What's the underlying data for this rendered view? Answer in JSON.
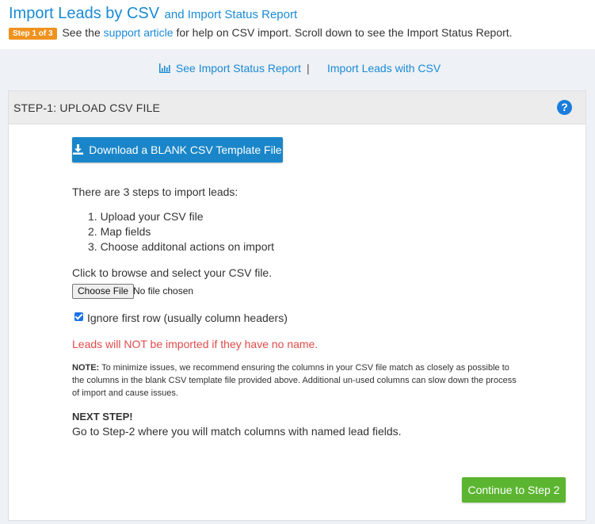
{
  "header": {
    "title_main": "Import Leads by CSV",
    "title_sub": "and Import Status Report",
    "step_badge": "Step 1 of 3",
    "sub_pre": "See the",
    "support_link": "support article",
    "sub_post": "for help on CSV import. Scroll down to see the Import Status Report."
  },
  "toplinks": {
    "status_report": "See Import Status Report",
    "separator": "|",
    "import_leads": "Import Leads with CSV"
  },
  "panel": {
    "title": "STEP-1: UPLOAD CSV FILE",
    "help_icon": "?",
    "download_button": "Download a BLANK CSV Template File",
    "intro": "There are 3 steps to import leads:",
    "steps": [
      "1. Upload your CSV file",
      "2. Map fields",
      "3. Choose additonal actions on import"
    ],
    "browse_text": "Click to browse and select your CSV file.",
    "choose_file_button": "Choose File",
    "no_file_text": "No file chosen",
    "ignore_first_row_label": "Ignore first row (usually column headers)",
    "ignore_first_row_checked": true,
    "warning": "Leads will NOT be imported if they have no name.",
    "note_label": "NOTE:",
    "note_text": "To minimize issues, we recommend ensuring the columns in your CSV file match as closely as possible to the columns in the blank CSV template file provided above. Additional un-used columns can slow down the process of import and cause issues.",
    "next_step_title": "NEXT STEP!",
    "next_step_text": "Go to Step-2 where you will match columns with named lead fields.",
    "continue_button": "Continue to Step 2"
  },
  "colors": {
    "link_blue": "#1a8ad6",
    "badge_orange": "#f0921e",
    "download_blue": "#1a86c9",
    "continue_green": "#5cb531",
    "warning_red": "#e04b4b"
  }
}
